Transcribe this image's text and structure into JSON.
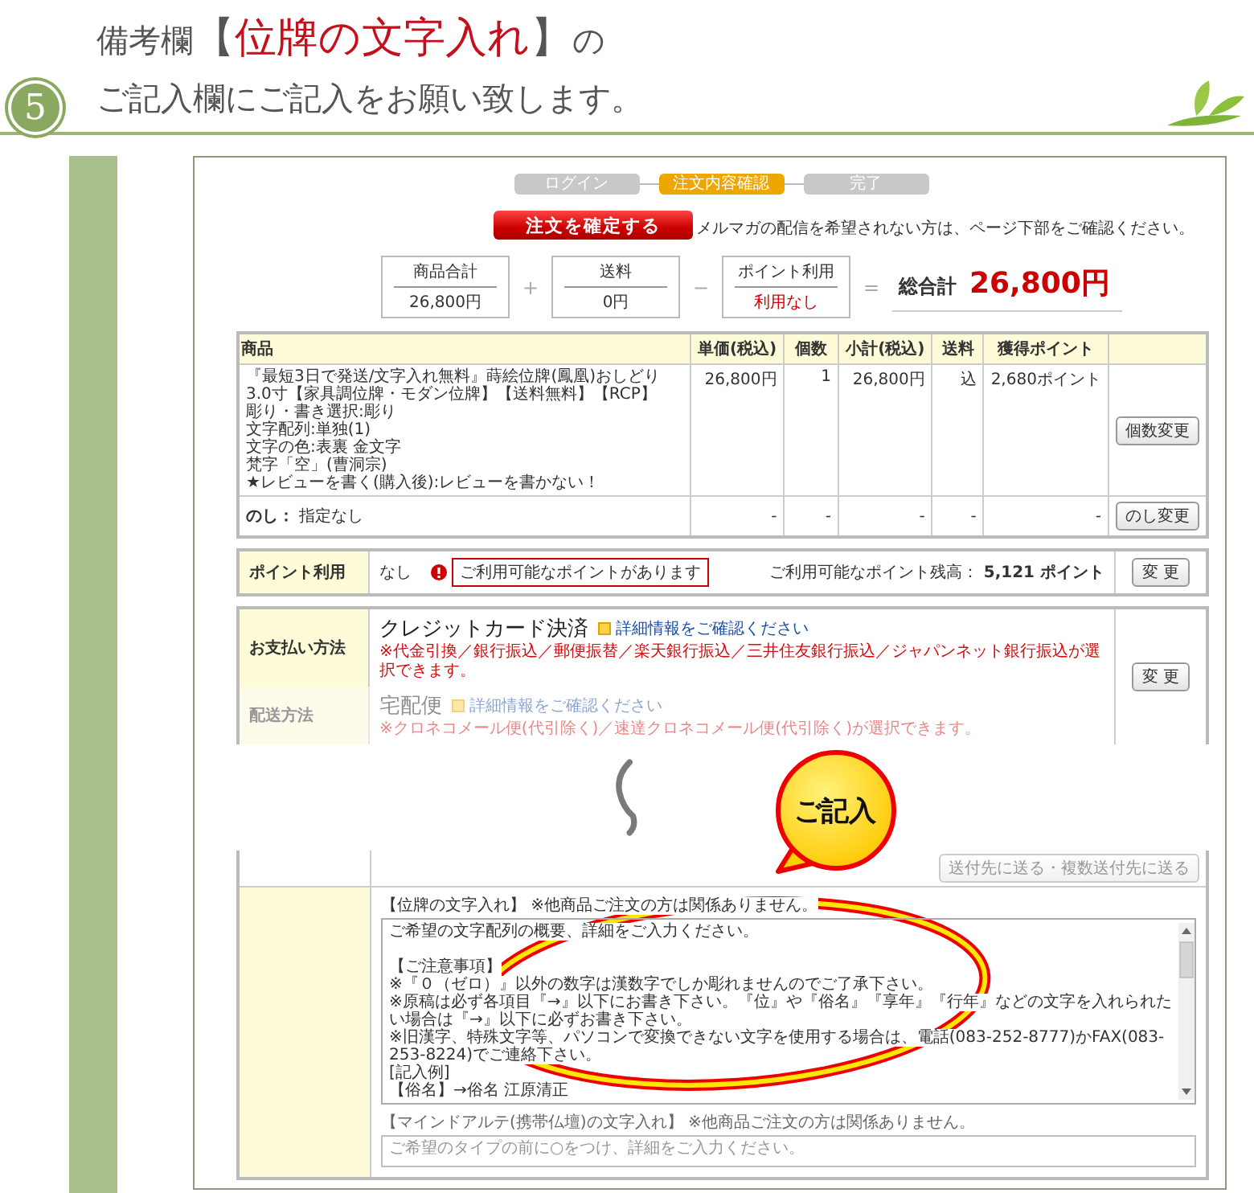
{
  "heading": {
    "step": "5",
    "line1_prefix": "備考欄",
    "bracket_open": "【",
    "highlight": "位牌の文字入れ",
    "bracket_close": "】",
    "line1_suffix": "の",
    "line2": "ご記入欄にご記入をお願い致します。"
  },
  "steps": [
    {
      "label": "ログイン",
      "selected": false
    },
    {
      "label": "注文内容確認",
      "selected": true
    },
    {
      "label": "完了",
      "selected": false
    }
  ],
  "confirm_button": "注文を確定する",
  "mail_note": "メルマガの配信を希望されない方は、ページ下部をご確認ください。",
  "totals": {
    "boxes": [
      {
        "label": "商品合計",
        "value": "26,800円",
        "kind": "plain"
      },
      {
        "label": "送料",
        "value": "0円",
        "kind": "plain"
      },
      {
        "label": "ポイント利用",
        "value": "利用なし",
        "kind": "alert"
      }
    ],
    "operators": [
      "+",
      "−",
      "="
    ],
    "grand_label": "総合計",
    "grand_value": "26,800円"
  },
  "order_table": {
    "columns": {
      "product": "商品",
      "unit_price": "単価(税込)",
      "quantity": "個数",
      "subtotal": "小計(税込)",
      "shipping": "送料",
      "points": "獲得ポイント"
    },
    "rows": [
      {
        "kind": "item",
        "product": [
          "『最短3日で発送/文字入れ無料』蒔絵位牌(鳳凰)おしどり 3.0寸【家具調位牌・モダン位牌】【送料無料】【RCP】",
          "彫り・書き選択:彫り",
          "文字配列:単独(1)",
          "文字の色:表裏 金文字",
          "梵字「空」(曹洞宗)",
          "★レビューを書く(購入後):レビューを書かない！"
        ],
        "unit_price": "26,800円",
        "quantity": "1",
        "subtotal": "26,800円",
        "shipping": "込",
        "points": "2,680ポイント",
        "button": "個数変更"
      },
      {
        "kind": "noshi",
        "product": [
          "**のし：** 指定なし"
        ],
        "unit_price": "-",
        "quantity": "-",
        "subtotal": "-",
        "shipping": "-",
        "points": "-",
        "button": "のし変更"
      }
    ]
  },
  "points": {
    "label": "ポイント利用",
    "value": "なし",
    "notice": "ご利用可能なポイントがあります",
    "balance": "ご利用可能なポイント残高： **5,121 ポイント**",
    "button": "変 更"
  },
  "payment": {
    "rows": [
      {
        "label": "お支払い方法",
        "method": "クレジットカード決済",
        "link": "詳細情報をご確認ください",
        "note": "※代金引換／銀行振込／郵便振替／楽天銀行振込／三井住友銀行振込／ジャパンネット銀行振込が選択できます。",
        "faded": false
      },
      {
        "label": "配送方法",
        "method": "宅配便",
        "link": "詳細情報をご確認ください",
        "note": "※クロネコメール便(代引除く)／速達クロネコメール便(代引除く)が選択できます。",
        "faded": true
      }
    ],
    "button": "変 更"
  },
  "delivery_button": "送付先に送る・複数送付先に送る",
  "remark_text": {
    "heading": "【位牌の文字入れ】 ※他商品ご注文の方は関係ありません。",
    "lines": [
      "ご希望の文字配列の概要、詳細をご入力ください。",
      "【ご注意事項】",
      "※『０（ゼロ）』以外の数字は漢数字でしか彫れませんのでご了承下さい。",
      "※原稿は必ず各項目『→』以下にお書き下さい。『位』や『俗名』『享年』『行年』などの文字を入れられたい場合は『→』以下に必ずお書き下さい。",
      "※旧漢字、特殊文字等、パソコンで変換できない文字を使用する場合は、電話(083-252-8777)かFAX(083-253-8224)でご連絡下さい。",
      "[記入例]",
      "【俗名】→俗名 江原清正"
    ]
  },
  "remark_field": {
    "heading": "【マインドアルテ(携帯仏壇)の文字入れ】 ※他商品ご注文の方は関係ありません。",
    "placeholder": "ご希望のタイプの前に○をつけ、詳細をご入力ください。",
    "faded": true
  },
  "callout": "ご記入"
}
